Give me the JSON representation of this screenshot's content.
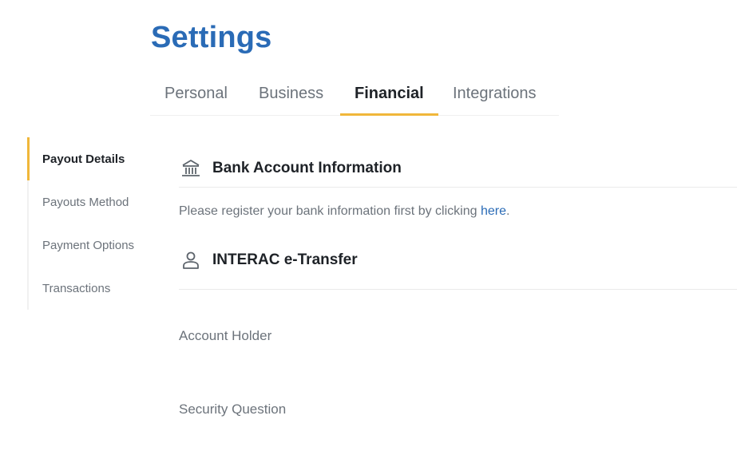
{
  "page": {
    "title": "Settings"
  },
  "tabs": [
    {
      "label": "Personal",
      "active": false
    },
    {
      "label": "Business",
      "active": false
    },
    {
      "label": "Financial",
      "active": true
    },
    {
      "label": "Integrations",
      "active": false
    }
  ],
  "sidebar": {
    "items": [
      {
        "label": "Payout Details",
        "active": true
      },
      {
        "label": "Payouts Method",
        "active": false
      },
      {
        "label": "Payment Options",
        "active": false
      },
      {
        "label": "Transactions",
        "active": false
      }
    ]
  },
  "bank_section": {
    "icon": "bank-icon",
    "title": "Bank Account Information",
    "message_prefix": "Please register your bank information first by clicking ",
    "link_text": "here",
    "message_suffix": "."
  },
  "interac_section": {
    "icon": "person-icon",
    "title": "INTERAC e-Transfer",
    "fields": [
      {
        "label": "Account Holder"
      },
      {
        "label": "Security Question"
      }
    ]
  },
  "colors": {
    "title": "#2a6bb6",
    "accent": "#f0b73a",
    "link": "#2a6bb6",
    "muted_text": "#6c737b"
  }
}
